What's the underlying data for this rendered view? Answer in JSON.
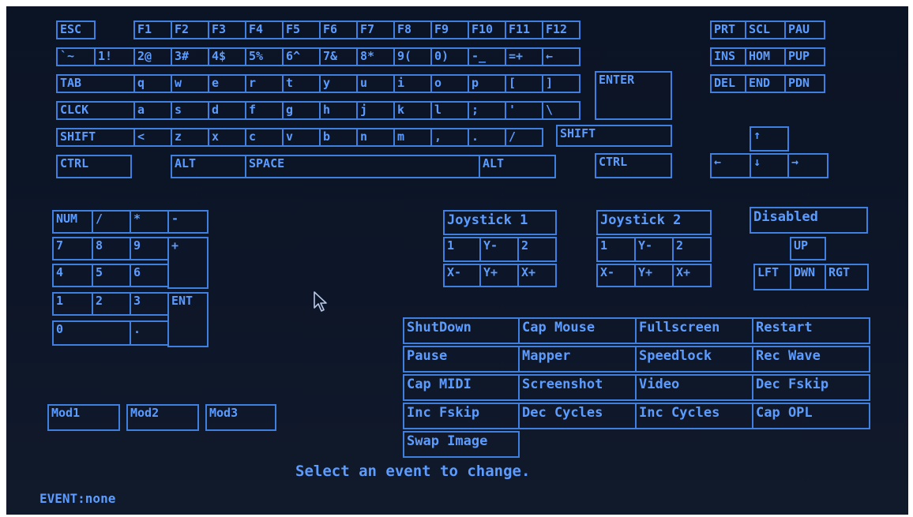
{
  "keyboard": {
    "fkeys": [
      "ESC",
      "F1",
      "F2",
      "F3",
      "F4",
      "F5",
      "F6",
      "F7",
      "F8",
      "F9",
      "F10",
      "F11",
      "F12"
    ],
    "row1": [
      "`~",
      "1!",
      "2@",
      "3#",
      "4$",
      "5%",
      "6^",
      "7&",
      "8*",
      "9(",
      "0)",
      "-_",
      "=+",
      "←"
    ],
    "row2": [
      "TAB",
      "q",
      "w",
      "e",
      "r",
      "t",
      "y",
      "u",
      "i",
      "o",
      "p",
      "[",
      "]",
      "ENTER"
    ],
    "row3": [
      "CLCK",
      "a",
      "s",
      "d",
      "f",
      "g",
      "h",
      "j",
      "k",
      "l",
      ";",
      "'",
      "\\"
    ],
    "row4": [
      "SHIFT",
      "<",
      "z",
      "x",
      "c",
      "v",
      "b",
      "n",
      "m",
      ",",
      ".",
      "/",
      "SHIFT"
    ],
    "row5": [
      "CTRL",
      "ALT",
      "SPACE",
      "ALT",
      "CTRL"
    ]
  },
  "nav": {
    "top": [
      "PRT",
      "SCL",
      "PAU"
    ],
    "mid": [
      "INS",
      "HOM",
      "PUP"
    ],
    "bot": [
      "DEL",
      "END",
      "PDN"
    ],
    "arrows": [
      "↑",
      "←",
      "↓",
      "→"
    ]
  },
  "numpad": {
    "keys": [
      "NUM",
      "/",
      "*",
      "-",
      "7",
      "8",
      "9",
      "+",
      "4",
      "5",
      "6",
      "1",
      "2",
      "3",
      "ENT",
      "0",
      "."
    ]
  },
  "joystick1": {
    "title": "Joystick 1",
    "keys": [
      "1",
      "Y-",
      "2",
      "X-",
      "Y+",
      "X+"
    ]
  },
  "joystick2": {
    "title": "Joystick 2",
    "keys": [
      "1",
      "Y-",
      "2",
      "X-",
      "Y+",
      "X+"
    ]
  },
  "hat": {
    "title": "Disabled",
    "keys": [
      "UP",
      "LFT",
      "DWN",
      "RGT"
    ]
  },
  "mods": [
    "Mod1",
    "Mod2",
    "Mod3"
  ],
  "events": [
    [
      "ShutDown",
      "Cap Mouse",
      "Fullscreen",
      "Restart"
    ],
    [
      "Pause",
      "Mapper",
      "Speedlock",
      "Rec Wave"
    ],
    [
      "Cap MIDI",
      "Screenshot",
      "Video",
      "Dec Fskip"
    ],
    [
      "Inc Fskip",
      "Dec Cycles",
      "Inc Cycles",
      "Cap OPL"
    ],
    [
      "Swap Image"
    ]
  ],
  "status": {
    "prompt": "Select an event to change.",
    "event": "EVENT:none"
  },
  "colors": {
    "background": "#0c1526",
    "key_border": "#3f7fe0",
    "key_text": "#5c9cff"
  }
}
